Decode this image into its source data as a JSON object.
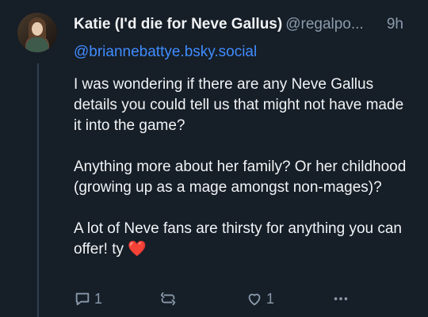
{
  "post": {
    "author_name": "Katie (I'd die for Neve Gallus)",
    "author_handle": "@regalpo...",
    "time": "9h",
    "mention": "@briannebattye.bsky.social",
    "paragraphs": [
      "I was wondering if there are any Neve Gallus details you could tell us that might not have made it into the game?",
      "Anything more about her family? Or her childhood (growing up as a mage amongst non-mages)?",
      "A lot of Neve fans are thirsty for anything you can offer! ty"
    ],
    "emoji": "❤️",
    "reply_count": "1",
    "like_count": "1"
  },
  "icons": {
    "reply": "speech-bubble-icon",
    "repost": "repost-arrows-icon",
    "like": "heart-outline-icon",
    "more": "ellipsis-icon"
  },
  "colors": {
    "background": "#161e27",
    "text": "#f1f3f5",
    "muted": "#8a9bac",
    "link": "#3f8cff",
    "heart": "#e3283a"
  }
}
